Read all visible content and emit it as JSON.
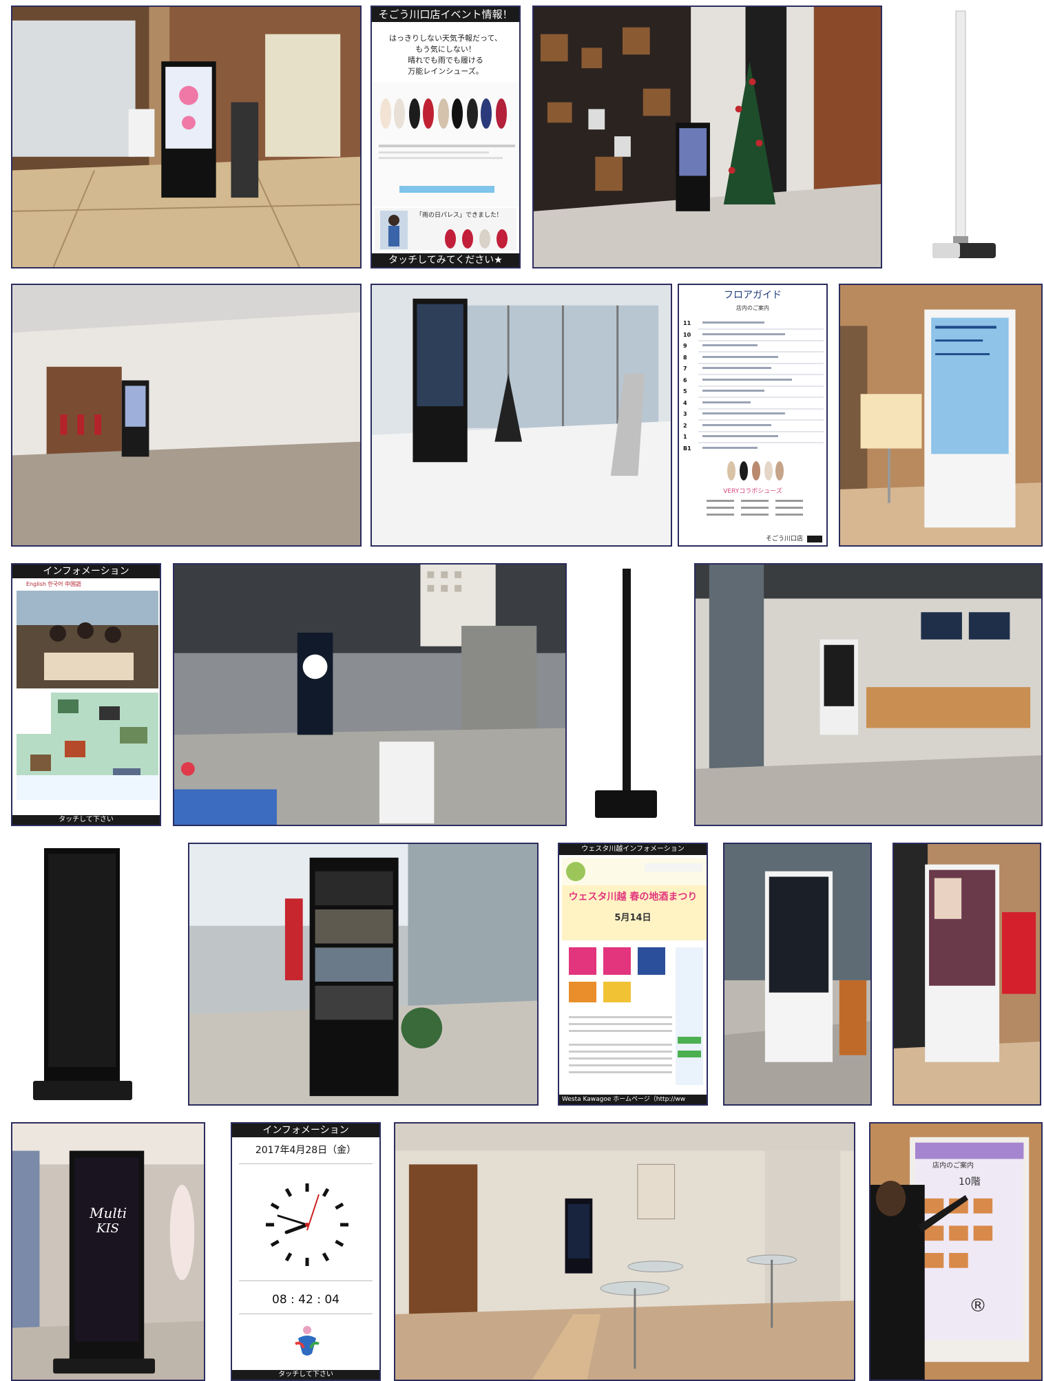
{
  "tiles": {
    "event_screen": {
      "title": "そごう川口店イベント情報！",
      "headline": [
        "はっきりしない天気予報だって、",
        "もう気にしない！",
        "晴れでも雨でも履ける",
        "万能レインシューズ。"
      ],
      "banner": "「雨の日パレス」できました!",
      "touch_label": "タッチしてみてください★"
    },
    "floor_guide": {
      "title": "フロアガイド",
      "subtitle": "店内のご案内",
      "floors": [
        "11",
        "10",
        "9",
        "8",
        "7",
        "6",
        "5",
        "4",
        "3",
        "2",
        "1",
        "B1"
      ],
      "promo": "VERYコラボシューズ",
      "store": "そごう川口店"
    },
    "info_screen": {
      "title": "インフォメーション",
      "languages": "English 한국어 中国語",
      "touch_label": "タッチして下さい"
    },
    "westa_screen": {
      "title": "ウェスタ川越インフォメーション",
      "event_title": "ウェスタ川越 春の地酒まつり",
      "event_date": "5月14日",
      "footer": "Westa Kawagoe ホームページ（http://ww"
    },
    "kiosk_brand": {
      "line1": "Multi",
      "line2": "KIS"
    },
    "clock_screen": {
      "title": "インフォメーション",
      "date": "2017年4月28日（金）",
      "time": "08 : 42 : 04",
      "touch_label": "タッチして下さい"
    },
    "menu_screen": {
      "title": "店内のご案内",
      "floor": "10階",
      "registered_mark": "®"
    }
  },
  "colors": {
    "frame": "#2b2c5e",
    "bar": "#1a1a1a",
    "floor_blue": "#1f3a7a",
    "westa_pink": "#e2357d",
    "clock_red": "#cc1f1f"
  }
}
